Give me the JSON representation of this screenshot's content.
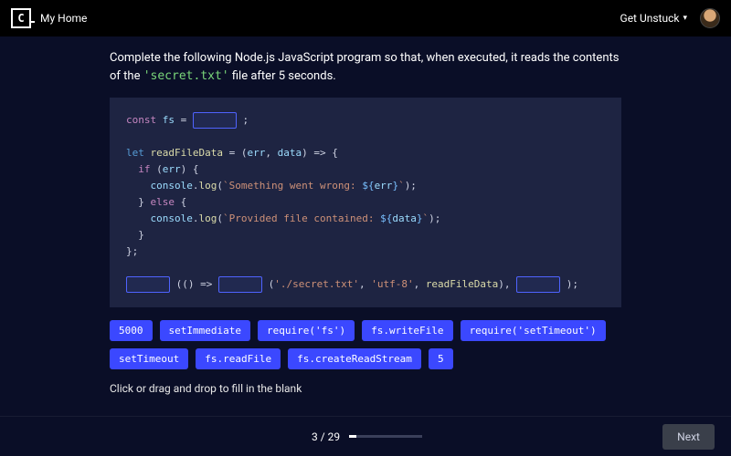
{
  "header": {
    "logo_letter": "C",
    "home_label": "My Home",
    "get_unstuck_label": "Get Unstuck"
  },
  "prompt": {
    "pre": "Complete the following Node.js JavaScript program so that, when executed, it reads the contents of the ",
    "filename": "'secret.txt'",
    "post": " file after 5 seconds."
  },
  "code": {
    "l1_a": "const ",
    "l1_b": "fs",
    "l1_c": " = ",
    "l1_d": " ;",
    "l3_a": "let ",
    "l3_b": "readFileData",
    "l3_c": " = (",
    "l3_d": "err",
    "l3_e": ", ",
    "l3_f": "data",
    "l3_g": ") => {",
    "l4_a": "  if ",
    "l4_b": "(",
    "l4_c": "err",
    "l4_d": ") {",
    "l5_a": "    console",
    "l5_b": ".",
    "l5_c": "log",
    "l5_d": "(",
    "l5_e": "`Something went wrong: ",
    "l5_f": "${",
    "l5_g": "err",
    "l5_h": "}",
    "l5_i": "`",
    "l5_j": ");",
    "l6_a": "  } ",
    "l6_b": "else ",
    "l6_c": "{",
    "l7_a": "    console",
    "l7_b": ".",
    "l7_c": "log",
    "l7_d": "(",
    "l7_e": "`Provided file contained: ",
    "l7_f": "${",
    "l7_g": "data",
    "l7_h": "}",
    "l7_i": "`",
    "l7_j": ");",
    "l8_a": "  }",
    "l9_a": "};",
    "l11_a": " (() => ",
    "l11_b": " (",
    "l11_c": "'./secret.txt'",
    "l11_d": ", ",
    "l11_e": "'utf-8'",
    "l11_f": ", ",
    "l11_g": "readFileData",
    "l11_h": "), ",
    "l11_i": " );"
  },
  "chips": [
    "5000",
    "setImmediate",
    "require('fs')",
    "fs.writeFile",
    "require('setTimeout')",
    "setTimeout",
    "fs.readFile",
    "fs.createReadStream",
    "5"
  ],
  "hint": "Click or drag and drop to fill in the blank",
  "footer": {
    "progress_label": "3 / 29",
    "progress_percent": 10,
    "next_label": "Next"
  }
}
